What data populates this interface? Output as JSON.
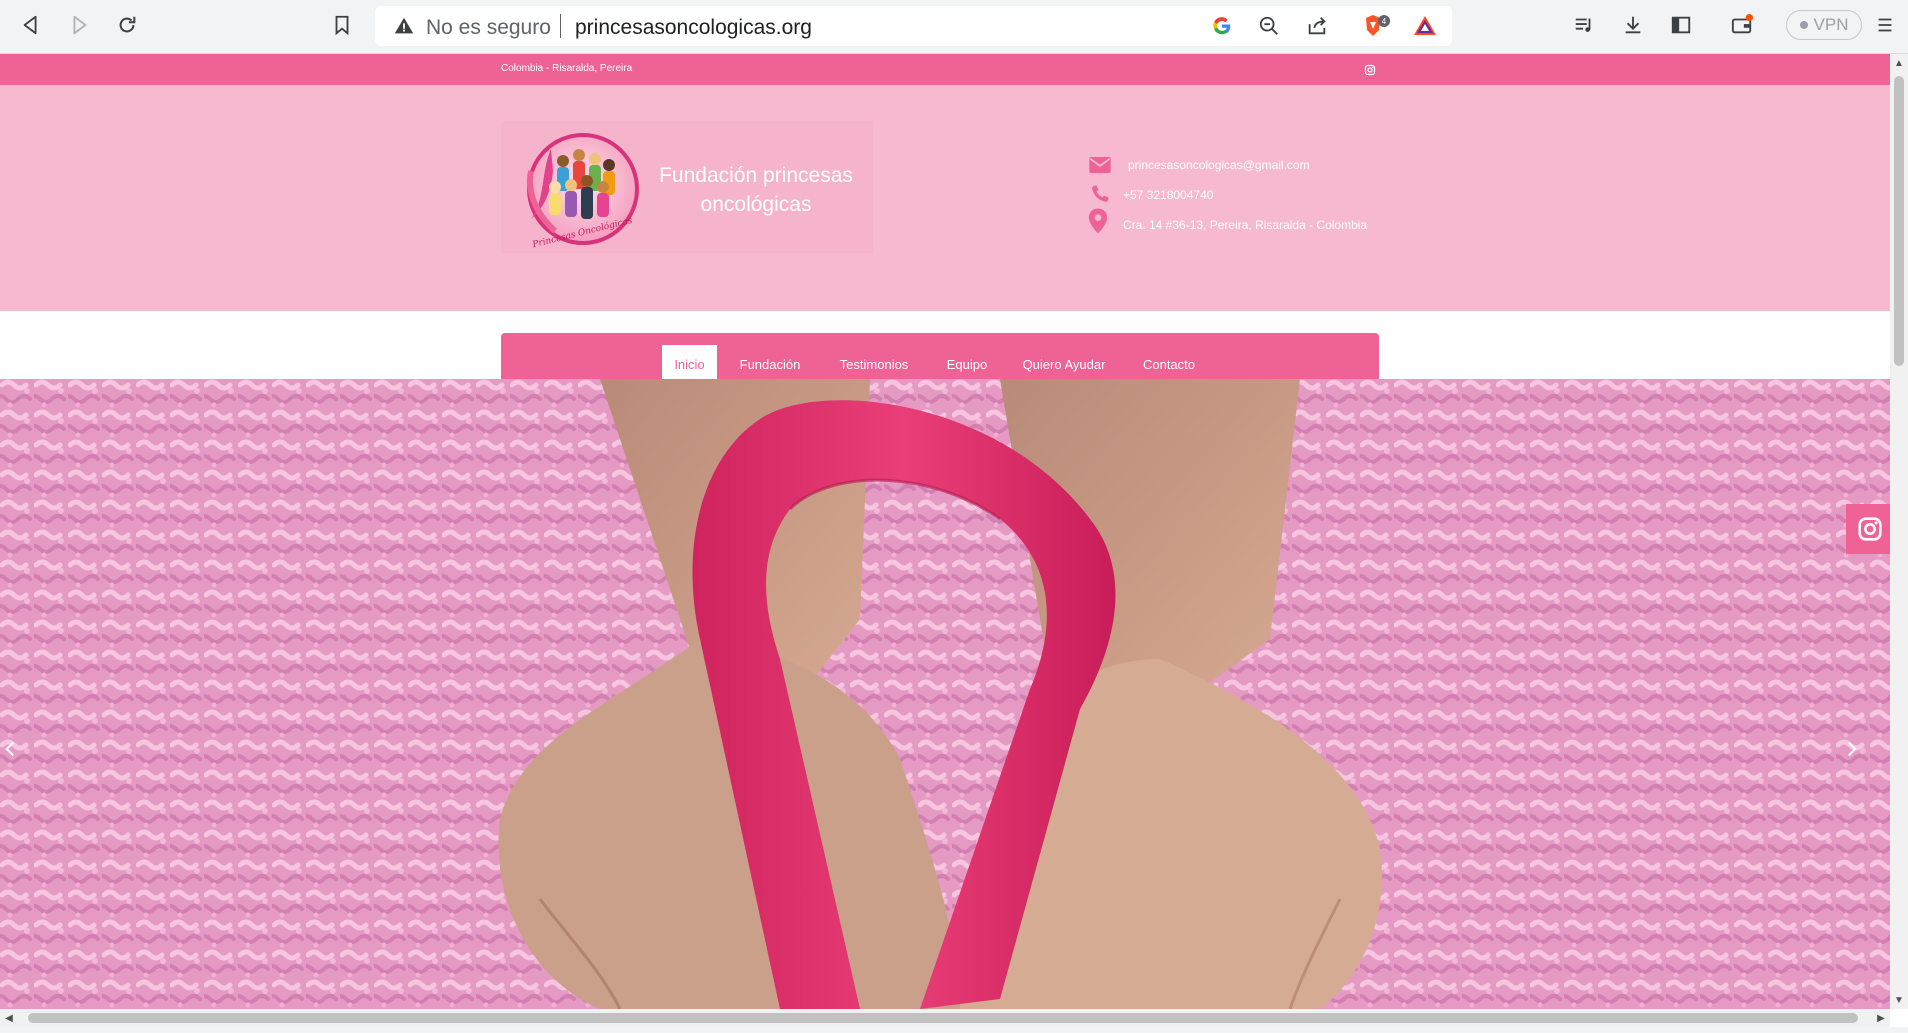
{
  "browser": {
    "security_label": "No es seguro",
    "url": "princesasoncologicas.org",
    "brave_badge_count": "4",
    "vpn_label": "VPN"
  },
  "site": {
    "location": "Colombia - Risaralda, Pereira",
    "title": "Fundación princesas oncológicas",
    "logo_text": "Princesas Oncológicas",
    "contact": {
      "email": "princesasoncologicas@gmail.com",
      "phone": "+57 3218004740",
      "address": "Cra. 14 #36-13, Pereira, Risaralda - Colombia"
    },
    "nav": [
      {
        "label": "Inicio",
        "active": true
      },
      {
        "label": "Fundación"
      },
      {
        "label": "Testimonios"
      },
      {
        "label": "Equipo"
      },
      {
        "label": "Quiero Ayudar"
      },
      {
        "label": "Contacto"
      }
    ]
  },
  "colors": {
    "accent": "#ee6296",
    "header_bg": "#f7b9cf"
  },
  "icons": {
    "back": "back-arrow-icon",
    "forward": "forward-arrow-icon",
    "reload": "reload-icon",
    "bookmark": "bookmark-icon",
    "google": "google-icon",
    "zoom": "zoom-out-icon",
    "share": "share-icon",
    "brave": "brave-shield-icon",
    "rewards": "brave-rewards-icon",
    "playlist": "playlist-icon",
    "download": "download-icon",
    "sidebar": "sidebar-icon",
    "wallet": "wallet-icon",
    "menu": "menu-icon",
    "email": "envelope-icon",
    "phone": "phone-icon",
    "map": "map-pin-icon",
    "instagram": "instagram-icon"
  }
}
